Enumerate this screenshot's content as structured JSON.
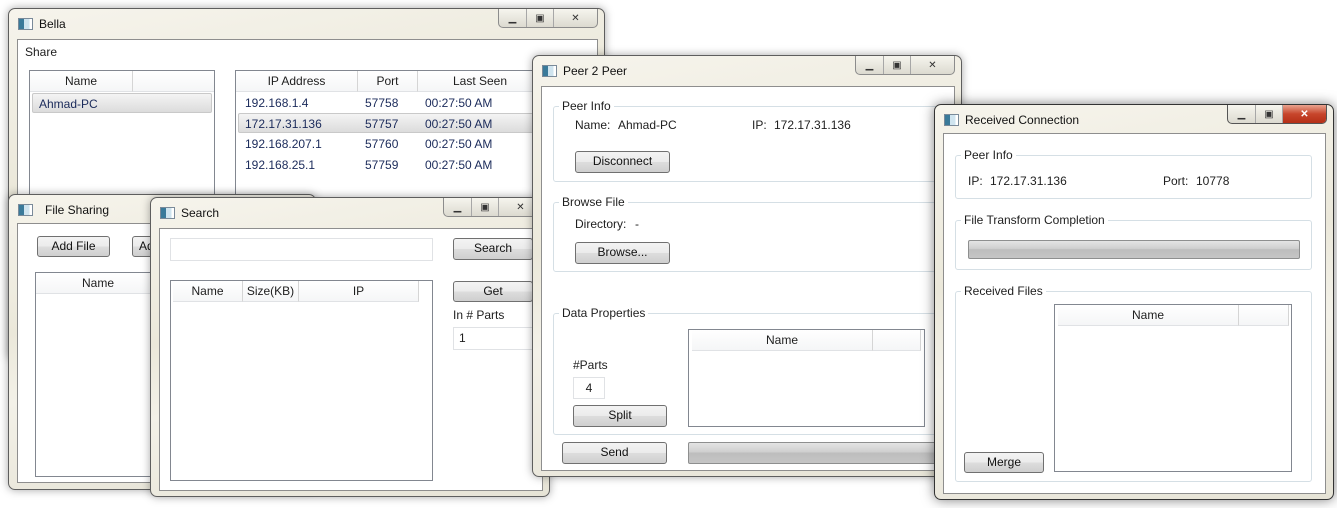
{
  "bella": {
    "title": "Bella",
    "menu": "Share",
    "names": {
      "header": "Name",
      "items": [
        "Ahmad-PC"
      ]
    },
    "peers": {
      "headers": [
        "IP Address",
        "Port",
        "Last Seen"
      ],
      "rows": [
        [
          "192.168.1.4",
          "57758",
          "00:27:50 AM"
        ],
        [
          "172.17.31.136",
          "57757",
          "00:27:50 AM"
        ],
        [
          "192.168.207.1",
          "57760",
          "00:27:50 AM"
        ],
        [
          "192.168.25.1",
          "57759",
          "00:27:50 AM"
        ]
      ],
      "selected_row": 1
    }
  },
  "file_sharing": {
    "title": "File Sharing",
    "add_file": "Add File",
    "second_button_partial": "Ad",
    "list_header": "Name"
  },
  "search": {
    "title": "Search",
    "query": "",
    "search_button": "Search",
    "headers": [
      "Name",
      "Size(KB)",
      "IP"
    ],
    "get_button": "Get",
    "parts_label": "In # Parts",
    "parts_value": "1"
  },
  "p2p": {
    "title": "Peer 2 Peer",
    "peer_info": {
      "label": "Peer Info",
      "name_label": "Name:",
      "name_value": "Ahmad-PC",
      "ip_label": "IP:",
      "ip_value": "172.17.31.136",
      "disconnect": "Disconnect"
    },
    "browse": {
      "label": "Browse File",
      "dir_label": "Directory:",
      "dir_value": "-",
      "button": "Browse..."
    },
    "data": {
      "label": "Data Properties",
      "parts_label": "#Parts",
      "parts_value": "4",
      "split": "Split",
      "list_header": "Name"
    },
    "send": "Send",
    "progress": 0
  },
  "received": {
    "title": "Received Connection",
    "peer_info": {
      "label": "Peer Info",
      "ip_label": "IP:",
      "ip_value": "172.17.31.136",
      "port_label": "Port:",
      "port_value": "10778"
    },
    "completion": {
      "label": "File Transform Completion",
      "progress": 0
    },
    "files": {
      "label": "Received Files",
      "list_header": "Name",
      "merge": "Merge"
    }
  }
}
